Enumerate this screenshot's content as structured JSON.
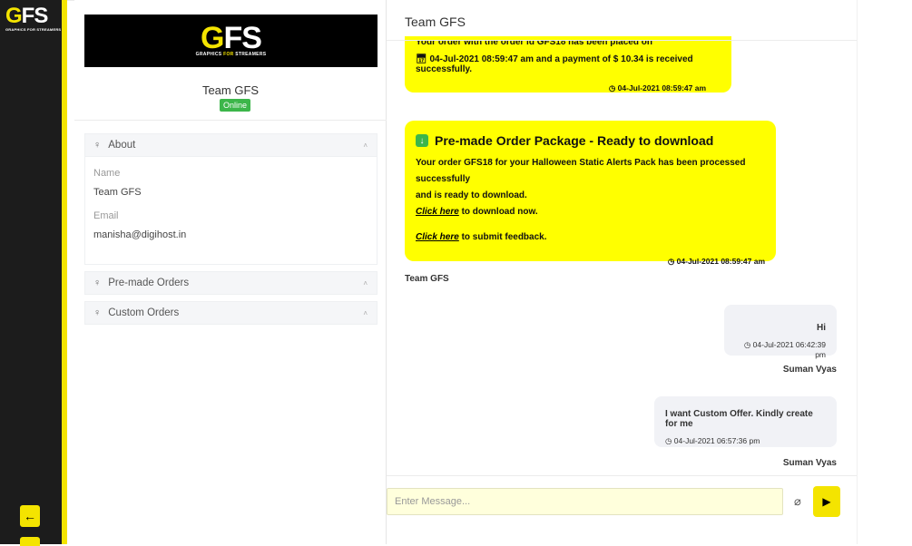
{
  "brand": {
    "logo_text_g": "G",
    "logo_text_rest": "FS",
    "tagline_part1": "GRAPHICS ",
    "tagline_part2": "FOR",
    "tagline_part3": " STREAMERS",
    "rail_tagline": "GRAPHICS FOR STREAMERS",
    "accent_color": "#f4e400"
  },
  "profile": {
    "name": "Team GFS",
    "status": "Online"
  },
  "accordion": {
    "about": {
      "title": "About",
      "name_label": "Name",
      "name_value": "Team GFS",
      "email_label": "Email",
      "email_value": "manisha@digihost.in"
    },
    "premade": {
      "title": "Pre-made Orders"
    },
    "custom": {
      "title": "Custom Orders"
    }
  },
  "chat": {
    "title": "Team GFS",
    "messages": {
      "m1": {
        "line1": "Your order with the order id GFS18 has been placed on",
        "line2": "04-Jul-2021 08:59:47 am and a payment of $ 10.34 is received successfully.",
        "time": "04-Jul-2021 08:59:47 am"
      },
      "m2": {
        "title": "Pre-made Order Package - Ready to download",
        "body1": "Your order GFS18 for your Halloween Static Alerts Pack has been processed successfully",
        "body2": "and is ready to download.",
        "link1": "Click here",
        "after_link1": " to download now.",
        "link2": "Click here",
        "after_link2": " to submit feedback.",
        "time": "04-Jul-2021 08:59:47 am"
      },
      "m2_sender": "Team GFS",
      "m3": {
        "text": "Hi",
        "time": "04-Jul-2021 06:42:39 pm",
        "sender": "Suman Vyas"
      },
      "m4": {
        "text": "I want Custom Offer. Kindly create for me",
        "time": "04-Jul-2021 06:57:36 pm",
        "sender": "Suman Vyas"
      }
    },
    "input_placeholder": "Enter Message..."
  },
  "icons": {
    "clock": "clock-icon",
    "calendar": "calendar-icon",
    "user": "user-icon",
    "chevron": "chevron-up-icon",
    "attach": "paperclip-icon",
    "send": "send-icon",
    "back": "arrow-left-icon"
  }
}
